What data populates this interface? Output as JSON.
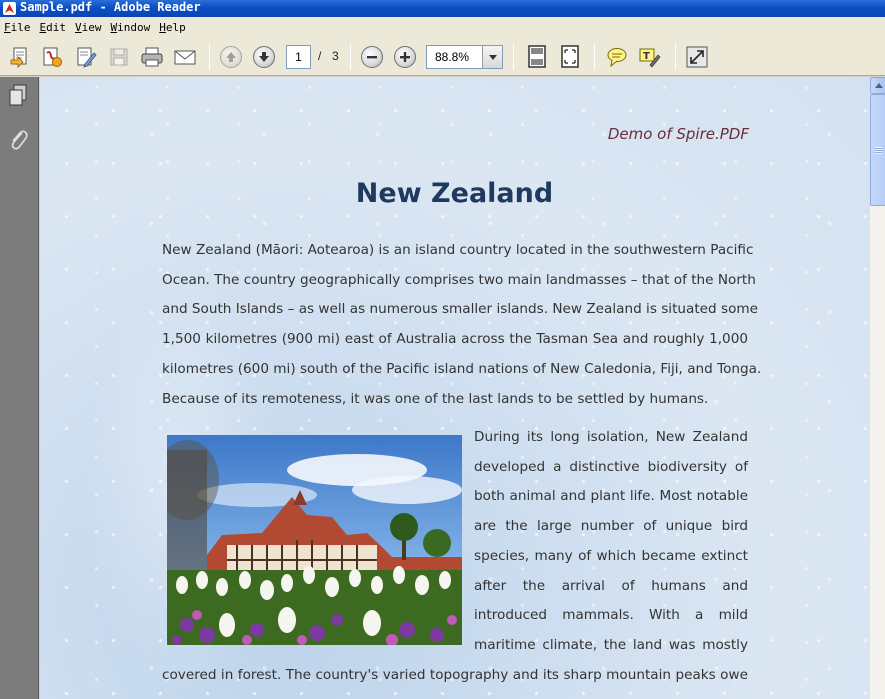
{
  "window": {
    "title": "Sample.pdf - Adobe Reader"
  },
  "menu": {
    "items": [
      "File",
      "Edit",
      "View",
      "Window",
      "Help"
    ]
  },
  "toolbar": {
    "page_current": "1",
    "page_separator": "/",
    "page_total": "3",
    "zoom": "88.8%",
    "buttons": [
      "open-icon",
      "create-pdf-icon",
      "edit-icon",
      "save-icon",
      "print-icon",
      "email-icon",
      "previous-page-icon",
      "next-page-icon",
      "zoom-out-icon",
      "zoom-in-icon",
      "fit-page-icon",
      "fit-width-icon",
      "comment-icon",
      "highlight-icon",
      "full-screen-icon"
    ]
  },
  "navpane": {
    "buttons": [
      "pages-icon",
      "attachments-icon"
    ]
  },
  "document": {
    "caption": "Demo of Spire.PDF",
    "title": "New Zealand",
    "lines": [
      "New Zealand (Māori: Aotearoa) is an island country located in the southwestern Pacific",
      "Ocean. The country geographically comprises two main landmasses – that of the North",
      "and South Islands – as well as numerous smaller islands. New Zealand is situated some",
      "1,500 kilometres (900 mi) east of Australia across the Tasman Sea and roughly 1,000",
      "kilometres (600 mi) south of the Pacific island nations of New Caledonia, Fiji, and Tonga.",
      "Because of its remoteness, it was one of the last lands to be settled by humans."
    ],
    "wrap_lines": [
      "During its long isolation, New Zealand",
      "developed a distinctive biodiversity of",
      "both animal and plant life. Most notable",
      "are the large number of unique bird",
      "species, many of which became extinct",
      "after the arrival of humans and",
      "introduced mammals. With a mild",
      "maritime climate, the land was mostly"
    ],
    "bottom_line": "covered in forest. The country's varied topography and its sharp mountain peaks owe"
  }
}
